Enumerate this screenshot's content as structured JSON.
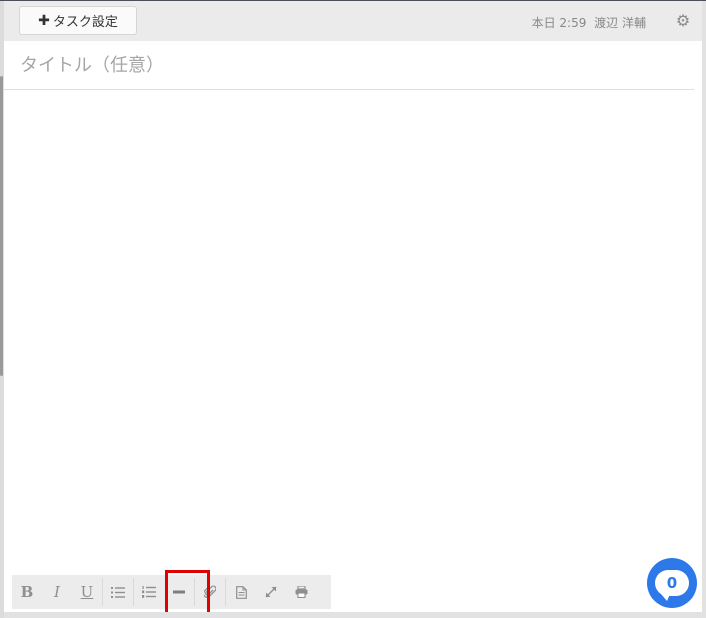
{
  "header": {
    "task_settings_label": "タスク設定",
    "task_settings_icon": "plus-icon",
    "meta": {
      "date": "本日 2:59",
      "author": "渡辺 洋輔"
    },
    "settings_icon": "gear-icon"
  },
  "editor": {
    "title_placeholder": "タイトル（任意）",
    "title_value": ""
  },
  "toolbar": {
    "items": [
      {
        "icon": "bold-icon",
        "label": "B"
      },
      {
        "icon": "italic-icon",
        "label": "I"
      },
      {
        "icon": "underline-icon",
        "label": "U"
      },
      {
        "icon": "bulleted-list-icon"
      },
      {
        "icon": "numbered-list-icon"
      },
      {
        "icon": "horizontal-rule-icon"
      },
      {
        "icon": "attachment-icon"
      },
      {
        "icon": "document-icon"
      },
      {
        "icon": "expand-icon"
      },
      {
        "icon": "print-icon"
      }
    ]
  },
  "chat": {
    "count": "0"
  },
  "colors": {
    "accent": "#2e79ea",
    "highlight": "#e00000",
    "toolbar_bg": "#ececec",
    "icon_gray": "#8f8f8f"
  }
}
